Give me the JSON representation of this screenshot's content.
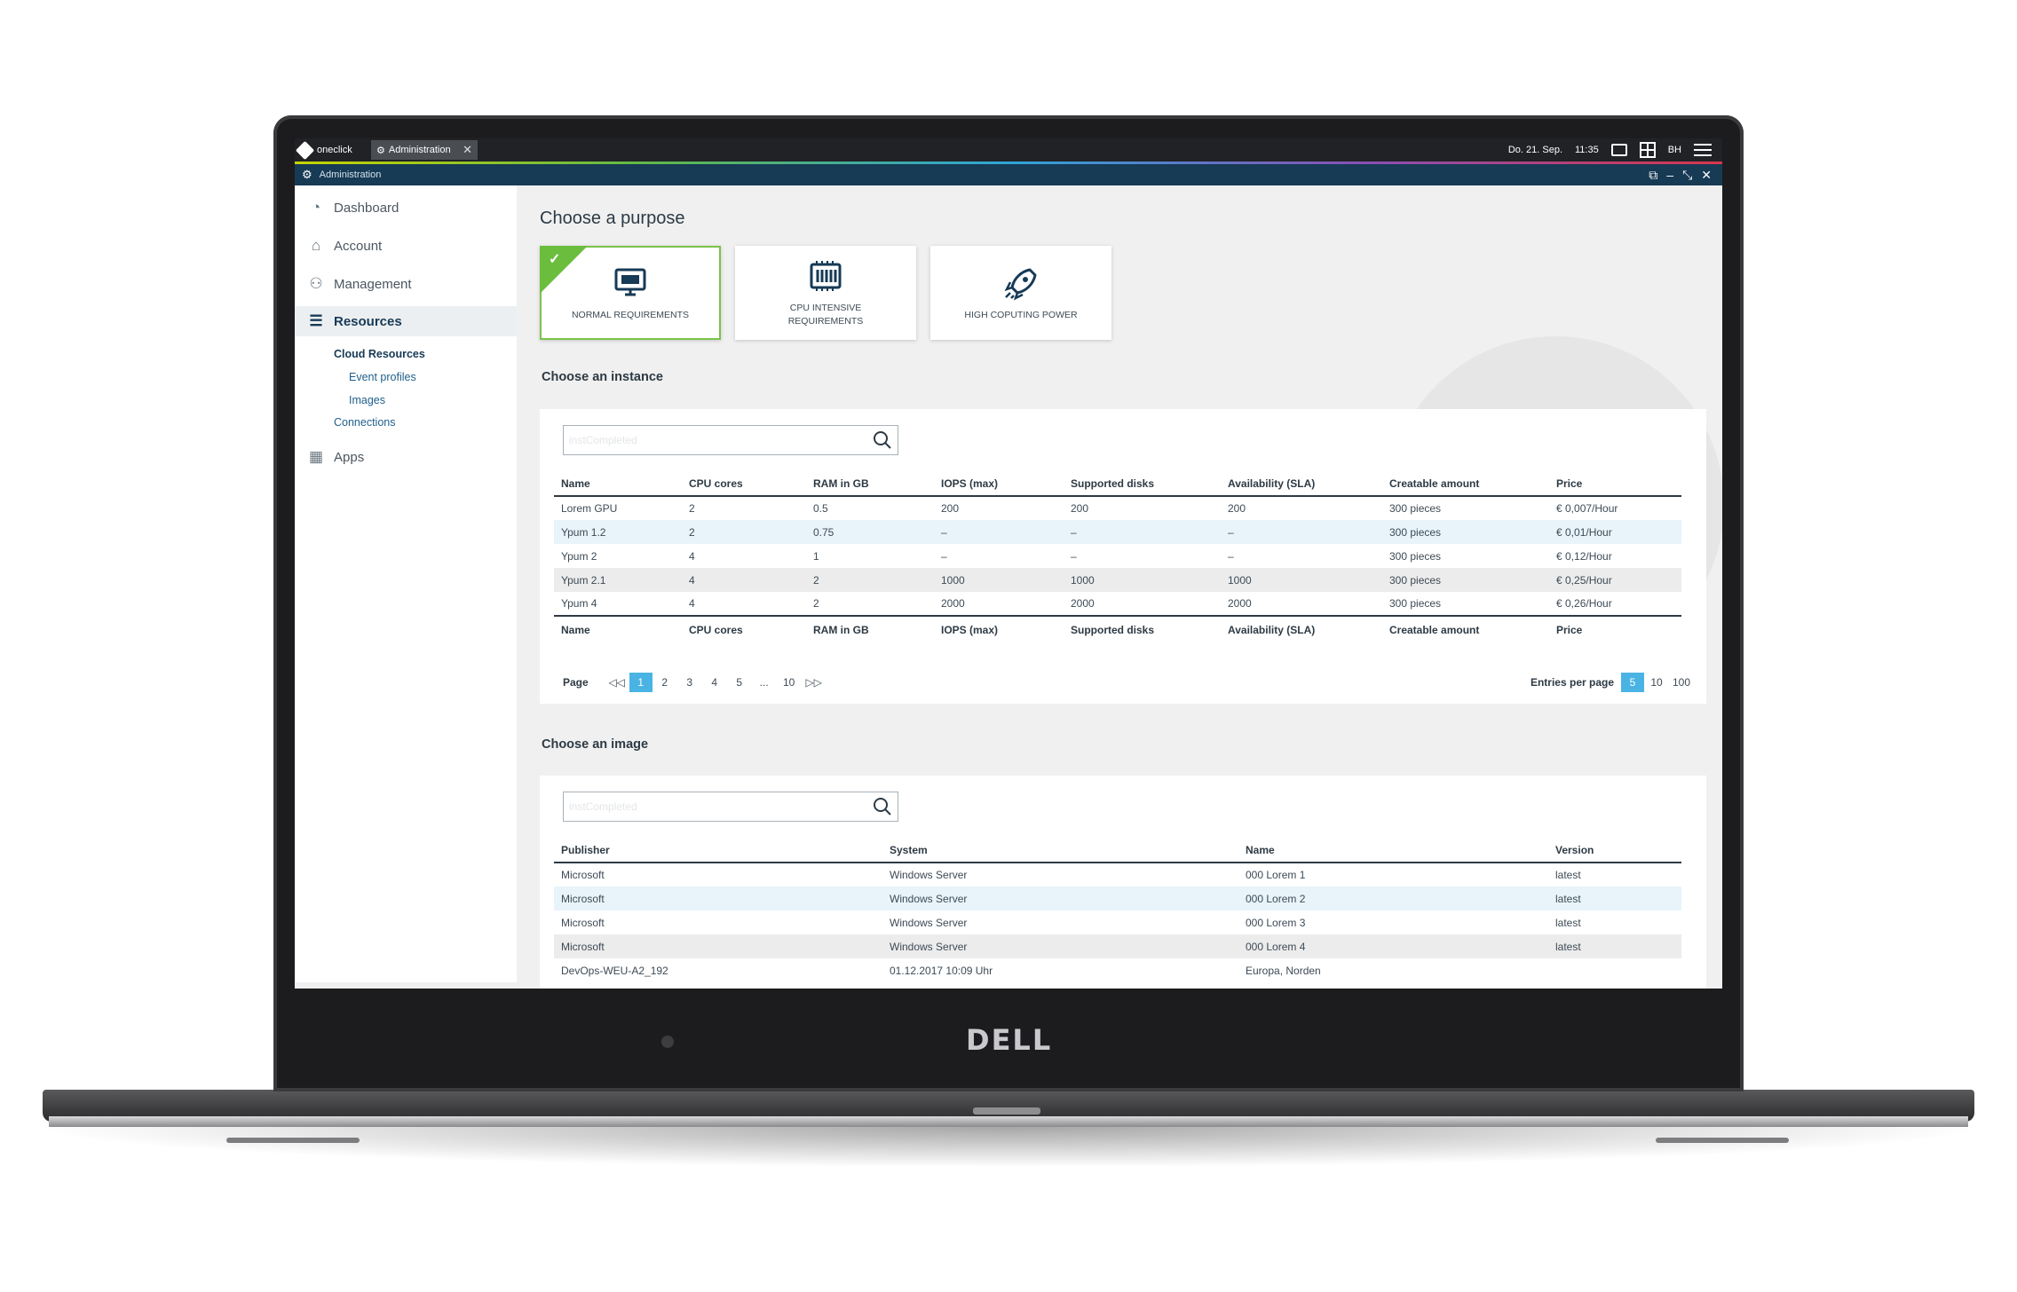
{
  "device": {
    "logo": "DELL"
  },
  "taskbar": {
    "brand": "oneclick",
    "tab_label": "Administration",
    "tab_close": "✕",
    "date": "Do. 21. Sep.",
    "time": "11:35",
    "user": "BH"
  },
  "window": {
    "title": "Administration"
  },
  "sidebar": {
    "items": [
      {
        "label": "Dashboard",
        "icon": "gauge-icon"
      },
      {
        "label": "Account",
        "icon": "home-icon"
      },
      {
        "label": "Management",
        "icon": "users-icon"
      },
      {
        "label": "Resources",
        "icon": "server-icon"
      },
      {
        "label": "Apps",
        "icon": "apps-icon"
      }
    ],
    "subitems": [
      "Cloud Resources",
      "Event profiles",
      "Images",
      "Connections"
    ]
  },
  "purpose": {
    "title": "Choose a purpose",
    "cards": [
      {
        "label": "NORMAL REQUIREMENTS",
        "icon": "monitor-icon",
        "selected": true
      },
      {
        "label": "CPU INTENSIVE REQUIREMENTS",
        "icon": "cpu-icon",
        "selected": false
      },
      {
        "label": "HIGH COPUTING POWER",
        "icon": "rocket-icon",
        "selected": false
      }
    ]
  },
  "instance": {
    "title": "Choose an instance",
    "search_placeholder": "instCompleted",
    "columns": [
      "Name",
      "CPU cores",
      "RAM in GB",
      "IOPS (max)",
      "Supported disks",
      "Availability (SLA)",
      "Creatable amount",
      "Price"
    ],
    "rows": [
      [
        "Lorem GPU",
        "2",
        "0.5",
        "200",
        "200",
        "200",
        "300 pieces",
        "€ 0,007/Hour"
      ],
      [
        "Ypum 1.2",
        "2",
        "0.75",
        "–",
        "–",
        "–",
        "300 pieces",
        "€ 0,01/Hour"
      ],
      [
        "Ypum 2",
        "4",
        "1",
        "–",
        "–",
        "–",
        "300 pieces",
        "€ 0,12/Hour"
      ],
      [
        "Ypum 2.1",
        "4",
        "2",
        "1000",
        "1000",
        "1000",
        "300 pieces",
        "€ 0,25/Hour"
      ],
      [
        "Ypum 4",
        "4",
        "2",
        "2000",
        "2000",
        "2000",
        "300 pieces",
        "€ 0,26/Hour"
      ]
    ],
    "pagination": {
      "label": "Page",
      "first": "◁◁",
      "pages": [
        "1",
        "2",
        "3",
        "4",
        "5",
        "...",
        "10"
      ],
      "last": "▷▷",
      "current": "1",
      "entries_label": "Entries per page",
      "entries_options": [
        "5",
        "10",
        "100"
      ],
      "entries_current": "5"
    }
  },
  "image": {
    "title": "Choose an image",
    "search_placeholder": "instCompleted",
    "columns": [
      "Publisher",
      "System",
      "Name",
      "Version"
    ],
    "rows": [
      [
        "Microsoft",
        "Windows Server",
        "000 Lorem 1",
        "latest"
      ],
      [
        "Microsoft",
        "Windows Server",
        "000 Lorem 2",
        "latest"
      ],
      [
        "Microsoft",
        "Windows Server",
        "000 Lorem 3",
        "latest"
      ],
      [
        "Microsoft",
        "Windows Server",
        "000 Lorem 4",
        "latest"
      ],
      [
        "DevOps-WEU-A2_192",
        "01.12.2017 10:09 Uhr",
        "Europa, Norden",
        ""
      ]
    ]
  },
  "colors": {
    "accent": "#49b4e3",
    "selected": "#6bbd3e",
    "header": "#173a55",
    "alt_row": "#e8f4fa"
  }
}
